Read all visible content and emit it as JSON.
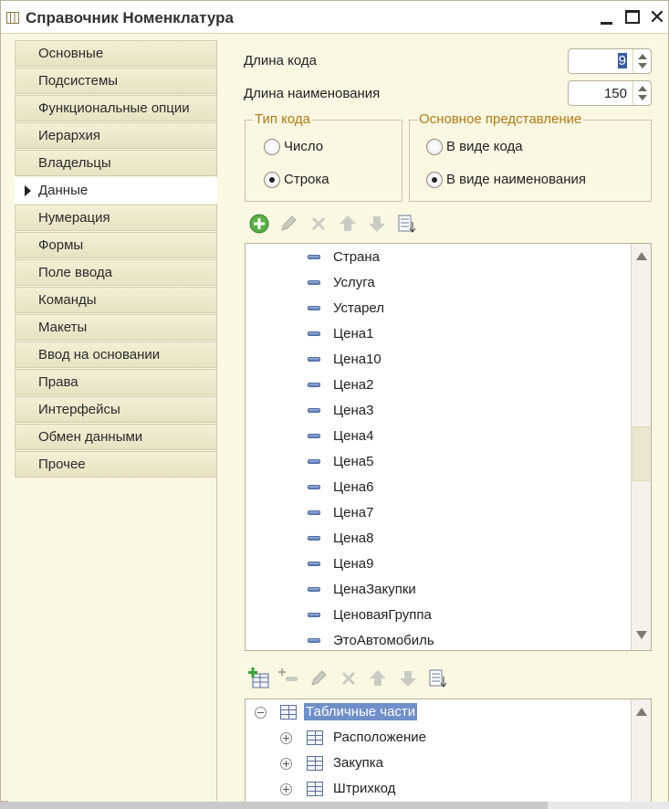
{
  "window": {
    "title": "Справочник Номенклатура"
  },
  "nav": {
    "items": [
      {
        "label": "Основные"
      },
      {
        "label": "Подсистемы"
      },
      {
        "label": "Функциональные опции"
      },
      {
        "label": "Иерархия"
      },
      {
        "label": "Владельцы"
      },
      {
        "label": "Данные",
        "active": true
      },
      {
        "label": "Нумерация"
      },
      {
        "label": "Формы"
      },
      {
        "label": "Поле ввода"
      },
      {
        "label": "Команды"
      },
      {
        "label": "Макеты"
      },
      {
        "label": "Ввод на основании"
      },
      {
        "label": "Права"
      },
      {
        "label": "Интерфейсы"
      },
      {
        "label": "Обмен данными"
      },
      {
        "label": "Прочее"
      }
    ]
  },
  "fields": {
    "code_length": {
      "label": "Длина кода",
      "value": "9"
    },
    "name_length": {
      "label": "Длина наименования",
      "value": "150"
    }
  },
  "code_type": {
    "title": "Тип кода",
    "options": [
      "Число",
      "Строка"
    ],
    "selected": "Строка"
  },
  "main_presentation": {
    "title": "Основное представление",
    "options": [
      "В виде кода",
      "В виде наименования"
    ],
    "selected": "В виде наименования"
  },
  "attributes": {
    "items": [
      "Страна",
      "Услуга",
      "Устарел",
      "Цена1",
      "Цена10",
      "Цена2",
      "Цена3",
      "Цена4",
      "Цена5",
      "Цена6",
      "Цена7",
      "Цена8",
      "Цена9",
      "ЦенаЗакупки",
      "ЦеноваяГруппа",
      "ЭтоАвтомобиль"
    ]
  },
  "tabular_parts": {
    "root": "Табличные части",
    "children": [
      "Расположение",
      "Закупка",
      "Штрихкод"
    ]
  },
  "icons": {
    "toolbar1": [
      "add-icon",
      "edit-icon",
      "delete-icon",
      "move-up-icon",
      "move-down-icon",
      "sort-icon"
    ],
    "toolbar2": [
      "add-table-icon",
      "add-attribute-icon",
      "edit-icon",
      "delete-icon",
      "move-up-icon",
      "move-down-icon",
      "sort-icon"
    ]
  },
  "colors": {
    "background": "#faf7e3",
    "group_title": "#b07a14",
    "selection": "#6f8fc9"
  }
}
